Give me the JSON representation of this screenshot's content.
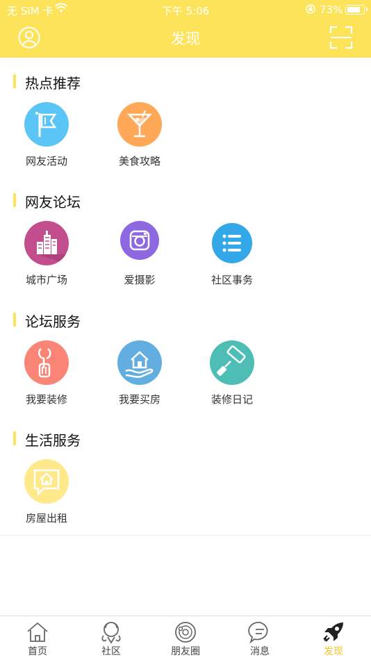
{
  "status_bar": {
    "carrier": "无 SIM 卡",
    "time": "下午 5:06",
    "battery": "73%",
    "battery_level": 0.73
  },
  "header": {
    "title": "发现",
    "avatar_icon": "user-avatar-icon",
    "scan_icon": "scan-icon",
    "bg_color": "#fde35a"
  },
  "sections": [
    {
      "title": "热点推荐",
      "items": [
        {
          "label": "网友活动",
          "icon": "flag-icon",
          "color": "#5bc6f5"
        },
        {
          "label": "美食攻略",
          "icon": "cocktail-icon",
          "color": "#fea858"
        }
      ]
    },
    {
      "title": "网友论坛",
      "items": [
        {
          "label": "城市广场",
          "icon": "buildings-icon",
          "color": "#c34e8e"
        },
        {
          "label": "爱摄影",
          "icon": "camera-icon",
          "color": "#8d68e0"
        },
        {
          "label": "社区事务",
          "icon": "list-icon",
          "color": "#33a8e8"
        }
      ]
    },
    {
      "title": "论坛服务",
      "items": [
        {
          "label": "我要装修",
          "icon": "wrench-icon",
          "color": "#fa8576"
        },
        {
          "label": "我要买房",
          "icon": "house-hand-icon",
          "color": "#62aee1"
        },
        {
          "label": "装修日记",
          "icon": "paint-roller-icon",
          "color": "#4dbdb6"
        }
      ]
    },
    {
      "title": "生活服务",
      "items": [
        {
          "label": "房屋出租",
          "icon": "house-chat-icon",
          "color": "#ffe98a"
        }
      ]
    }
  ],
  "tabbar": {
    "tabs": [
      {
        "label": "首页",
        "icon": "home-icon"
      },
      {
        "label": "社区",
        "icon": "community-icon"
      },
      {
        "label": "朋友圈",
        "icon": "moments-icon"
      },
      {
        "label": "消息",
        "icon": "message-icon"
      },
      {
        "label": "发现",
        "icon": "rocket-icon",
        "active": true
      }
    ],
    "active_color": "#f6c624"
  }
}
